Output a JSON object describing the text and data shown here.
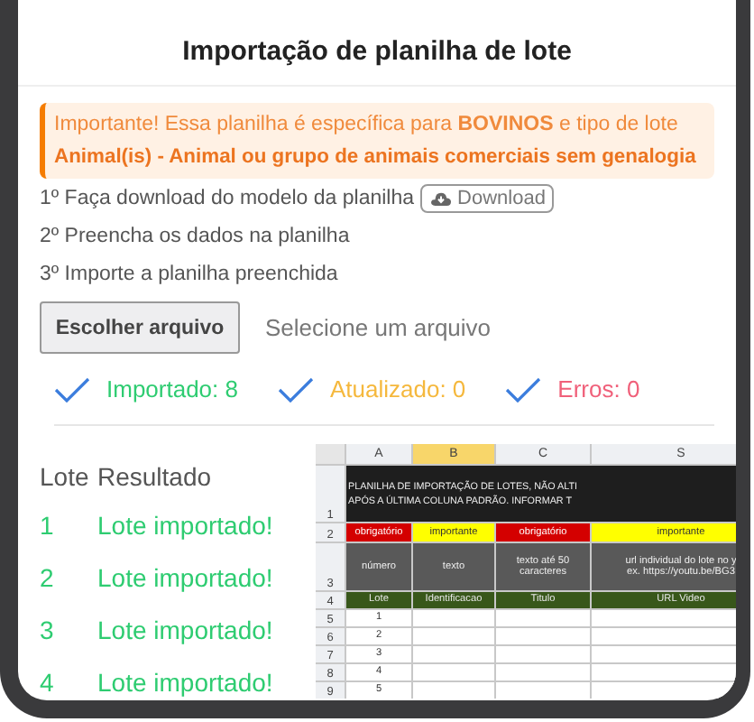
{
  "title": "Importação de planilha de lote",
  "alert": {
    "line_1": "Importante! Essa planilha é específica para **BOVINOS** e tipo de lote",
    "line_2": "Animal(is) - Animal ou grupo de animais comerciais sem genalogia"
  },
  "steps": [
    {
      "text": "1º Faça download do modelo da planilha",
      "button": "Download"
    },
    {
      "text": "2º Preencha os dados na planilha"
    },
    {
      "text": "3º Importe a planilha preenchida"
    }
  ],
  "file_picker": {
    "button": "Escolher arquivo",
    "status": "Selecione um arquivo"
  },
  "summary": [
    {
      "label": "Importado: 8",
      "kind": "success"
    },
    {
      "label": "Atualizado: 0",
      "kind": "updated"
    },
    {
      "label": "Erros: 0",
      "kind": "error"
    }
  ],
  "results": {
    "columns": [
      "Lote",
      "Resultado"
    ],
    "rows": [
      {
        "lote": "1",
        "result": "Lote importado!"
      },
      {
        "lote": "2",
        "result": "Lote importado!"
      },
      {
        "lote": "3",
        "result": "Lote importado!"
      },
      {
        "lote": "4",
        "result": "Lote importado!"
      }
    ]
  },
  "spreadsheet": {
    "columns": [
      {
        "label": "A",
        "selected": false
      },
      {
        "label": "B",
        "selected": true
      },
      {
        "label": "C",
        "selected": false
      },
      {
        "label": "S",
        "selected": false
      }
    ],
    "rows": [
      {
        "number": "1",
        "kind": "banner",
        "lines": [
          "PLANILHA DE IMPORTAÇÃO DE LOTES, NÃO ALTI",
          "APÓS A ÚLTIMA COLUNA PADRÃO. INFORMAR T"
        ]
      },
      {
        "number": "2",
        "kind": "tags",
        "cells": [
          {
            "text": "obrigatório",
            "kind": "required"
          },
          {
            "text": "importante",
            "kind": "important"
          },
          {
            "text": "obrigatório",
            "kind": "required"
          },
          {
            "text": "importante",
            "kind": "important"
          }
        ]
      },
      {
        "number": "3",
        "kind": "notes",
        "cells": [
          "número",
          "texto",
          "texto até 50 caracteres",
          "url individual do lote no y\nex. https://youtu.be/BG3"
        ]
      },
      {
        "number": "4",
        "kind": "headers",
        "cells": [
          "Lote",
          "Identificacao",
          "Titulo",
          "URL Video"
        ]
      },
      {
        "number": "5",
        "kind": "data",
        "cells": [
          "1"
        ]
      },
      {
        "number": "6",
        "kind": "data",
        "cells": [
          "2"
        ]
      },
      {
        "number": "7",
        "kind": "data",
        "cells": [
          "3"
        ]
      },
      {
        "number": "8",
        "kind": "data",
        "cells": [
          "4"
        ]
      },
      {
        "number": "9",
        "kind": "data",
        "cells": [
          "5"
        ]
      }
    ]
  }
}
